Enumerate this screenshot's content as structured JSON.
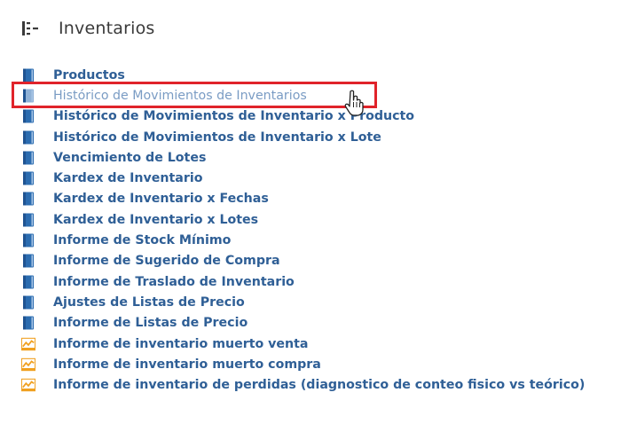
{
  "header": {
    "title": "Inventarios",
    "icon": "list-indent-icon"
  },
  "colors": {
    "link": "#2f5f96",
    "link_active": "#7a9cc4",
    "book_icon": "#2b6cb0",
    "chart_icon": "#f0a020",
    "highlight": "#e0232a"
  },
  "items": [
    {
      "label": "Productos",
      "icon": "book-icon"
    },
    {
      "label": "Histórico de Movimientos de Inventarios",
      "icon": "book-icon",
      "active": true
    },
    {
      "label": "Histórico de Movimientos de Inventario x Producto",
      "icon": "book-icon"
    },
    {
      "label": "Histórico de Movimientos de Inventario x Lote",
      "icon": "book-icon"
    },
    {
      "label": "Vencimiento de Lotes",
      "icon": "book-icon"
    },
    {
      "label": "Kardex de Inventario",
      "icon": "book-icon"
    },
    {
      "label": "Kardex de Inventario x Fechas",
      "icon": "book-icon"
    },
    {
      "label": "Kardex de Inventario x Lotes",
      "icon": "book-icon"
    },
    {
      "label": "Informe de Stock Mínimo",
      "icon": "book-icon"
    },
    {
      "label": "Informe de Sugerido de Compra",
      "icon": "book-icon"
    },
    {
      "label": "Informe de Traslado de Inventario",
      "icon": "book-icon"
    },
    {
      "label": "Ajustes de Listas de Precio",
      "icon": "book-icon"
    },
    {
      "label": "Informe de Listas de Precio",
      "icon": "book-icon"
    },
    {
      "label": "Informe de inventario muerto venta",
      "icon": "chart-icon"
    },
    {
      "label": "Informe de inventario muerto compra",
      "icon": "chart-icon"
    },
    {
      "label": "Informe de inventario de perdidas (diagnostico de conteo fisico vs teórico)",
      "icon": "chart-icon"
    }
  ]
}
